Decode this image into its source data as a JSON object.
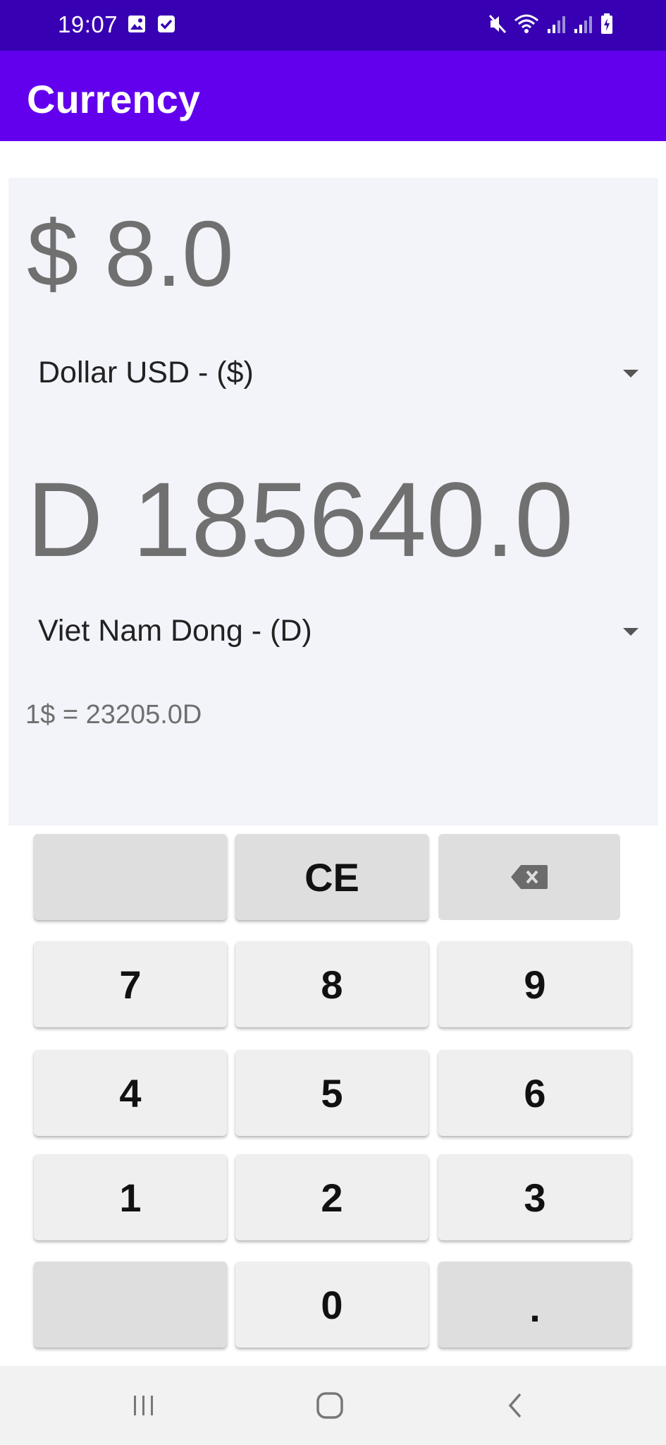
{
  "status_bar": {
    "time": "19:07"
  },
  "app_bar": {
    "title": "Currency"
  },
  "converter": {
    "from_amount": "$ 8.0",
    "from_currency": "Dollar USD - ($)",
    "to_amount": "D 185640.0",
    "to_currency": "Viet Nam Dong - (D)",
    "rate": "1$ = 23205.0D"
  },
  "keypad": {
    "ce": "CE",
    "k7": "7",
    "k8": "8",
    "k9": "9",
    "k4": "4",
    "k5": "5",
    "k6": "6",
    "k1": "1",
    "k2": "2",
    "k3": "3",
    "k0": "0",
    "dot": "."
  },
  "colors": {
    "status_bar": "#3700b3",
    "app_bar": "#6200ee",
    "panel_bg": "#f3f4fa",
    "amount_text": "#707070"
  }
}
